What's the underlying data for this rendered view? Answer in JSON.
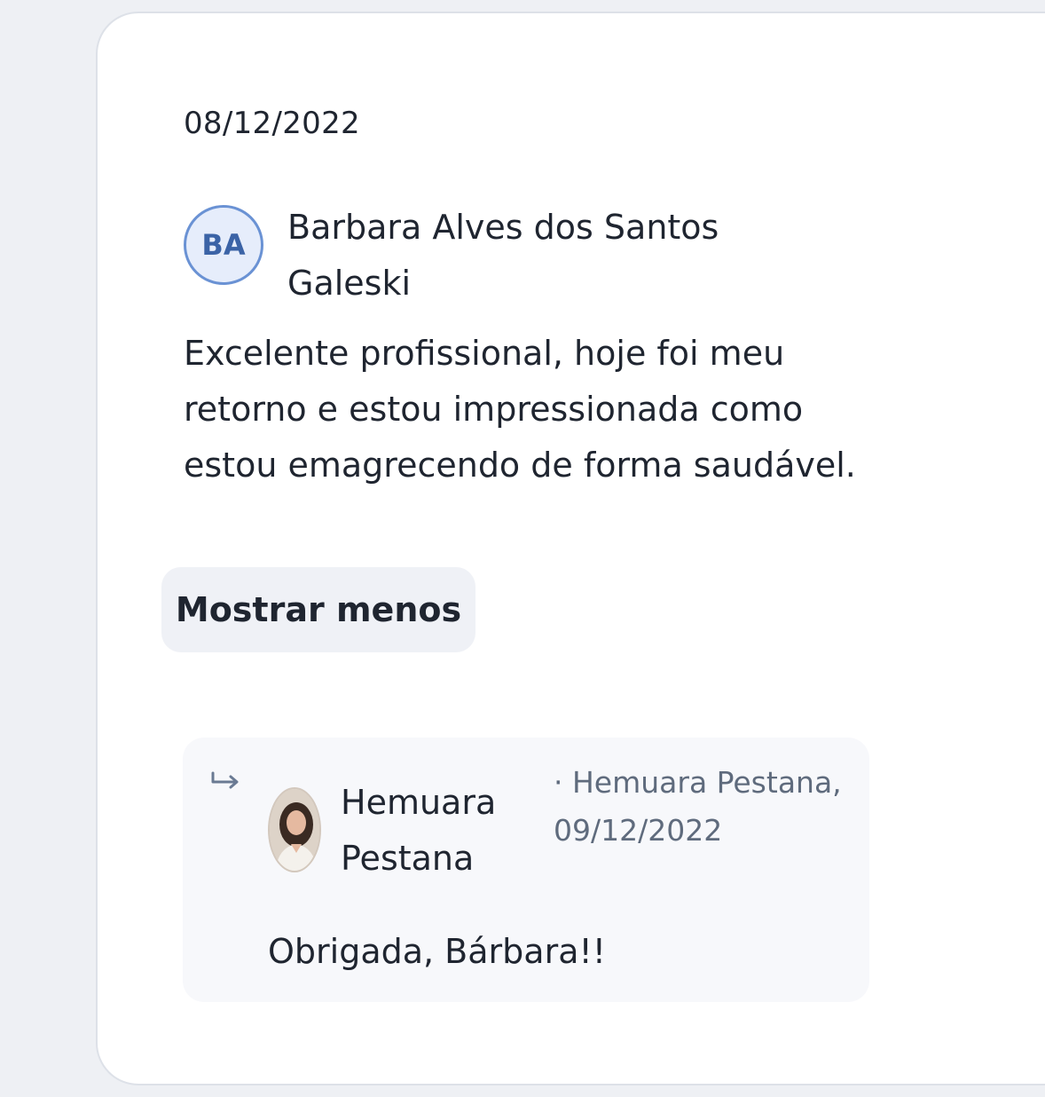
{
  "review": {
    "date": "08/12/2022",
    "author_initials": "BA",
    "author_name": "Barbara Alves dos Santos Galeski",
    "text": "Excelente profissional, hoje foi meu retorno e estou impressionada como estou emagrecendo de forma saudável.",
    "toggle_label": "Mostrar menos"
  },
  "reply": {
    "icon": "reply-arrow-icon",
    "author_name": "Hemuara Pestana",
    "meta": "· Hemuara Pestana, 09/12/2022",
    "text": "Obrigada, Bárbara!!"
  },
  "colors": {
    "avatar_border": "#6a92d4",
    "avatar_bg": "#e6edfb",
    "avatar_text": "#3b63a6",
    "muted_text": "#5f6b7d"
  }
}
